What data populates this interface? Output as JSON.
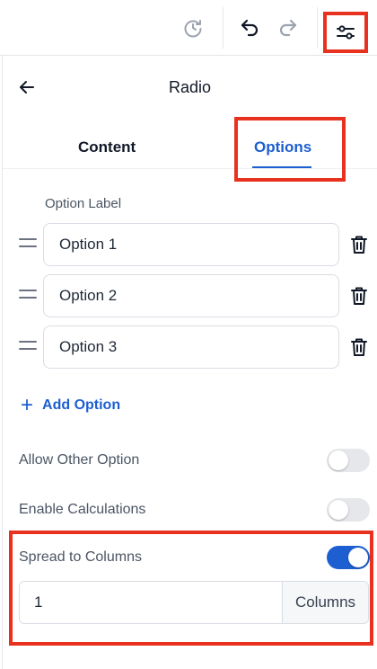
{
  "toolbar": {
    "history_icon": "history-clock-icon",
    "undo_icon": "undo-icon",
    "redo_icon": "redo-icon",
    "settings_icon": "settings-sliders-icon",
    "highlight_color": "#e8321f"
  },
  "panel": {
    "title": "Radio",
    "back_icon": "arrow-left-icon"
  },
  "tabs": [
    {
      "label": "Content",
      "active": false
    },
    {
      "label": "Options",
      "active": true
    }
  ],
  "options": {
    "section_label": "Option Label",
    "items": [
      {
        "value": "Option 1"
      },
      {
        "value": "Option 2"
      },
      {
        "value": "Option 3"
      }
    ],
    "add_label": "Add Option"
  },
  "settings": {
    "allow_other": {
      "label": "Allow Other Option",
      "enabled": false
    },
    "enable_calculations": {
      "label": "Enable Calculations",
      "enabled": false
    },
    "spread_to_columns": {
      "label": "Spread to Columns",
      "enabled": true
    },
    "columns": {
      "value": "1",
      "suffix": "Columns"
    }
  },
  "colors": {
    "accent": "#1d5fd1",
    "toggle_off": "#e5e7eb",
    "highlight": "#e8321f"
  }
}
